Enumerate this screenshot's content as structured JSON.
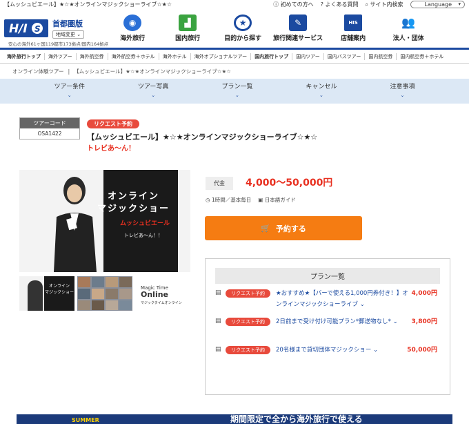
{
  "topbar": {
    "page_title": "【ムッシュビエール】★☆★オンラインマジックショーライブ☆★☆",
    "links": [
      "初めての方へ",
      "よくある質問",
      "サイト内検索"
    ],
    "language": "Language"
  },
  "header": {
    "logo_text": "HIS",
    "region_name": "首都圏版",
    "region_change": "地域変更",
    "region_note": "安心の海外61ヶ国119都市173拠点/国内164拠点",
    "nav": [
      {
        "label": "海外旅行",
        "icon": "globe-icon",
        "color": "#2a6fd6"
      },
      {
        "label": "国内旅行",
        "icon": "japan-map-icon",
        "color": "#3aa340"
      },
      {
        "label": "目的から探す",
        "icon": "search-star-icon",
        "color": "#1b4aa0"
      },
      {
        "label": "旅行関連サービス",
        "icon": "clipboard-icon",
        "color": "#1b4aa0"
      },
      {
        "label": "店舗案内",
        "icon": "store-icon",
        "color": "#1b4aa0"
      },
      {
        "label": "法人・団体",
        "icon": "group-icon",
        "color": "#1b4aa0"
      }
    ]
  },
  "subnav": [
    {
      "label": "海外旅行トップ",
      "bold": true
    },
    {
      "label": "海外ツアー",
      "bold": false
    },
    {
      "label": "海外航空券",
      "bold": false
    },
    {
      "label": "海外航空券＋ホテル",
      "bold": false
    },
    {
      "label": "海外ホテル",
      "bold": false
    },
    {
      "label": "海外オプショナルツアー",
      "bold": false
    },
    {
      "label": "国内旅行トップ",
      "bold": true
    },
    {
      "label": "国内ツアー",
      "bold": false
    },
    {
      "label": "国内バスツアー",
      "bold": false
    },
    {
      "label": "国内航空券",
      "bold": false
    },
    {
      "label": "国内航空券＋ホテル",
      "bold": false
    }
  ],
  "breadcrumb": [
    "オンライン体験ツアー",
    "【ムッシュビエール】★☆★オンラインマジックショーライブ☆★☆"
  ],
  "tabs": [
    "ツアー条件",
    "ツアー写真",
    "プラン一覧",
    "キャンセル",
    "注意事項"
  ],
  "tour": {
    "code_label": "ツアーコード",
    "code": "OSA1422",
    "request_badge": "リクエスト予約",
    "title": "【ムッシュビエール】★☆★オンラインマジックショーライブ☆★☆",
    "subtitle": "トレビあ〜ん！",
    "price_label": "代金",
    "price": "4,000〜50,000円",
    "duration": "1時間／基本毎日",
    "guide": "日本語ガイド",
    "book_button": "予約する"
  },
  "image_text": {
    "line1": "オンライン",
    "line2": "マジックショー",
    "line3": "ムッシュビエール",
    "line4": "トレビあ〜ん！！",
    "thumb1_line1": "オンライン",
    "thumb1_line2": "マジックショー",
    "thumb3_line1": "Magic Time",
    "thumb3_line2": "Online",
    "thumb3_line3": "マジックタイムオンライン"
  },
  "plans": {
    "heading": "プラン一覧",
    "items": [
      {
        "badge": "リクエスト予約",
        "name": "★おすすめ★【バーで使える1,000円券付き！】オンラインマジックショーライブ",
        "price": "4,000円"
      },
      {
        "badge": "リクエスト予約",
        "name": "2日前まで受け付け可能プラン*郵送物なし*",
        "price": "3,800円"
      },
      {
        "badge": "リクエスト予約",
        "name": "20名様まで貸切団体マジックショー",
        "price": "50,000円"
      }
    ]
  },
  "banner": {
    "small": "SUMMER",
    "text": "期間限定で全から海外旅行で使える"
  }
}
